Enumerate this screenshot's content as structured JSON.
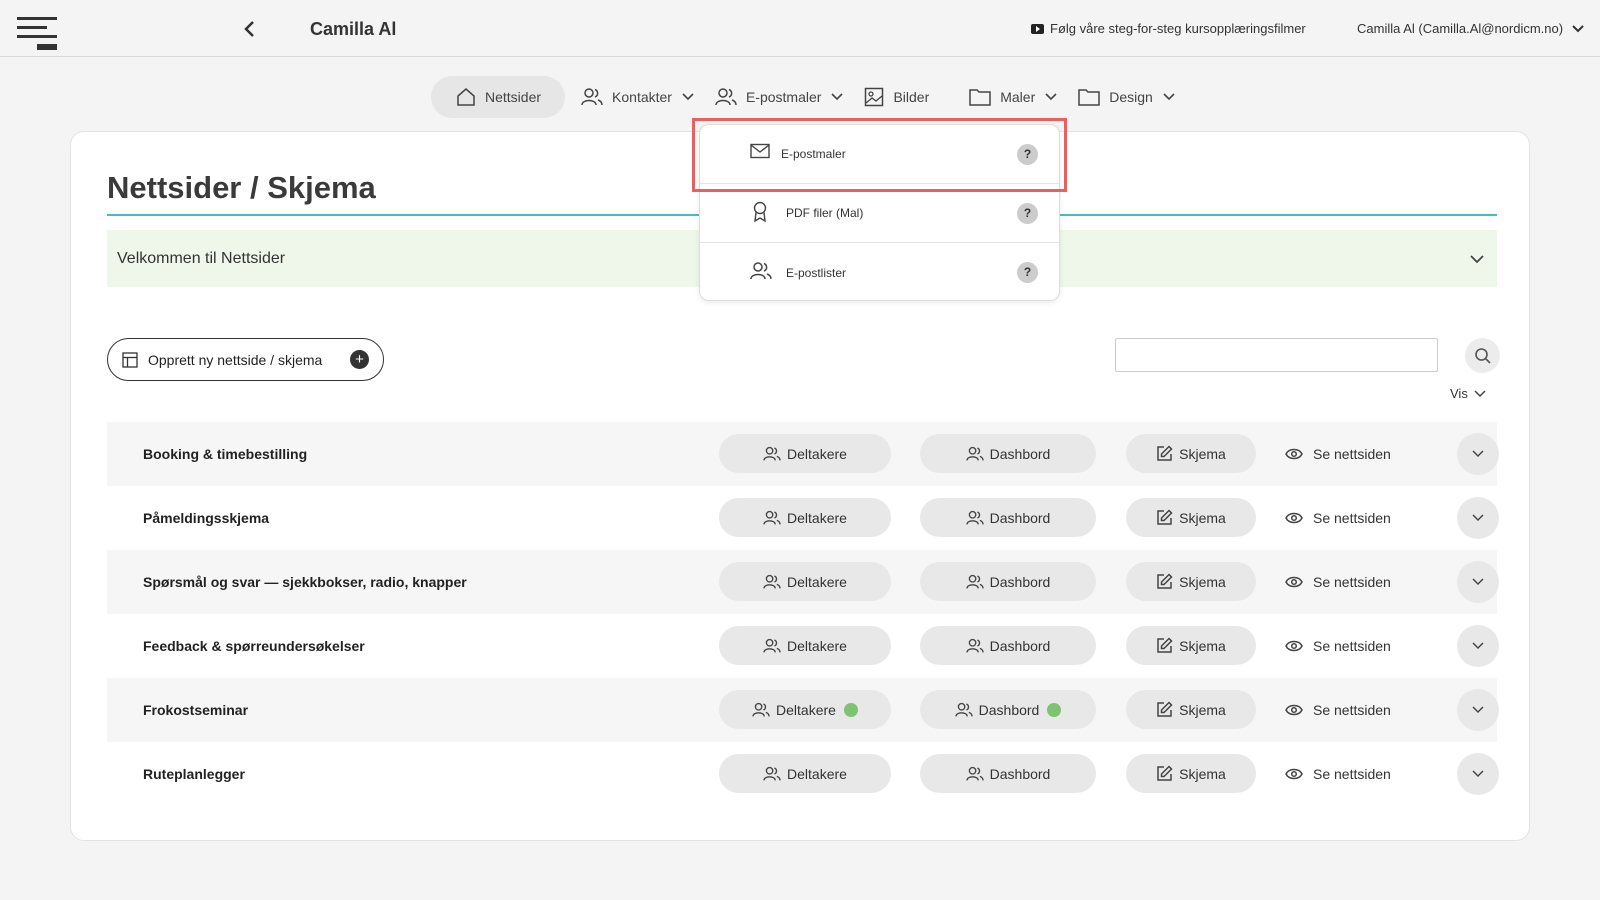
{
  "header": {
    "title": "Camilla Al",
    "video_link": "Følg våre steg-for-steg kursopplæringsfilmer",
    "user": "Camilla Al (Camilla.Al@nordicm.no)"
  },
  "nav": {
    "tabs": [
      "Nettsider",
      "Kontakter",
      "E-postmaler",
      "Bilder",
      "Maler",
      "Design"
    ]
  },
  "dropdown": {
    "items": [
      "E-postmaler",
      "PDF filer (Mal)",
      "E-postlister"
    ],
    "help": "?"
  },
  "page": {
    "title": "Nettsider / Skjema",
    "welcome": "Velkommen til Nettsider",
    "create_label": "Opprett ny nettside / skjema",
    "create_plus": "+",
    "search_value": "",
    "vis_label": "Vis"
  },
  "row_actions": {
    "participants": "Deltakere",
    "dashboard": "Dashbord",
    "form": "Skjema",
    "view": "Se nettsiden"
  },
  "rows": [
    {
      "title": "Booking & timebestilling",
      "status_dots": false
    },
    {
      "title": "Påmeldingsskjema",
      "status_dots": false
    },
    {
      "title": "Spørsmål og svar — sjekkbokser, radio, knapper",
      "status_dots": false
    },
    {
      "title": "Feedback & spørreundersøkelser",
      "status_dots": false
    },
    {
      "title": "Frokostseminar",
      "status_dots": true
    },
    {
      "title": "Ruteplanlegger",
      "status_dots": false
    }
  ],
  "colors": {
    "accent_line": "#4db6c9",
    "welcome_bg": "#eef7ea",
    "status_dot": "#7cc46f",
    "highlight": "#e8605f"
  }
}
